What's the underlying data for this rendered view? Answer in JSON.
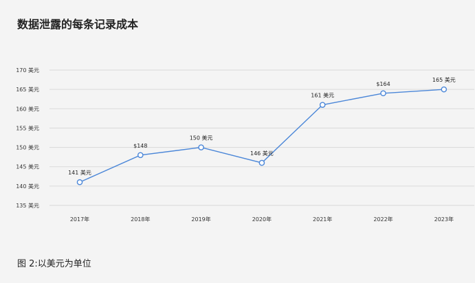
{
  "chart_data": {
    "type": "line",
    "title": "数据泄露的每条记录成本",
    "caption": "图 2:以美元为单位",
    "categories": [
      "2017年",
      "2018年",
      "2019年",
      "2020年",
      "2021年",
      "2022年",
      "2023年"
    ],
    "series": [
      {
        "values": [
          141,
          148,
          150,
          146,
          161,
          164,
          165
        ],
        "data_labels": [
          "141 美元",
          "$148",
          "150 美元",
          "146 美元",
          "161 美元",
          "$164",
          "165 美元"
        ]
      }
    ],
    "yticks": [
      "135 美元",
      "140 美元",
      "145 美元",
      "150 美元",
      "155 美元",
      "160 美元",
      "165 美元",
      "170 美元"
    ],
    "ylim": [
      135,
      170
    ],
    "grid": true,
    "line_color": "#4a86d8",
    "marker_fill": "#ffffff"
  }
}
